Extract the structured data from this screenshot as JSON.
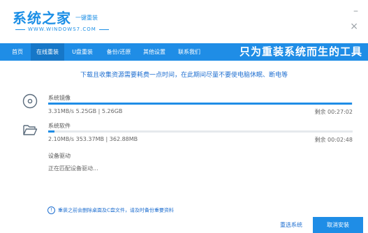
{
  "header": {
    "logo_main": "系统之家",
    "logo_tag": "一键重装",
    "logo_url": "WWW.WINDOWS7.COM",
    "minimize_symbol": "–",
    "close_symbol": "×"
  },
  "nav": {
    "items": [
      "首页",
      "在线重装",
      "U盘重装",
      "备份/还原",
      "其他设置",
      "联系我们"
    ],
    "active_index": 1,
    "slogan": "只为重装系统而生的工具"
  },
  "notice": "下载且收集资源需要耗费一点时间，在此期间尽量不要使电脑休眠、断电等",
  "tasks": [
    {
      "icon": "disc-icon",
      "name": "系统镜像",
      "stats": "3.31MB/s 5.25GB | 5.26GB",
      "remain": "剩余 00:27:02",
      "progress": 0.998
    },
    {
      "icon": "folder-icon",
      "name": "系统软件",
      "stats": "2.10MB/s 353.37MB | 362.88MB",
      "remain": "剩余 00:02:48",
      "progress": 0.02
    }
  ],
  "driver": {
    "name": "设备驱动",
    "status": "正在匹配设备驱动..."
  },
  "footer": {
    "warning": "重装之前会删除桌面及C盘文件，请及时备份重要资料",
    "reselect": "重选系统",
    "cancel": "取消安装"
  },
  "colors": {
    "accent": "#1f8de6",
    "active_nav": "#1677c8",
    "link": "#1f6fd0"
  }
}
